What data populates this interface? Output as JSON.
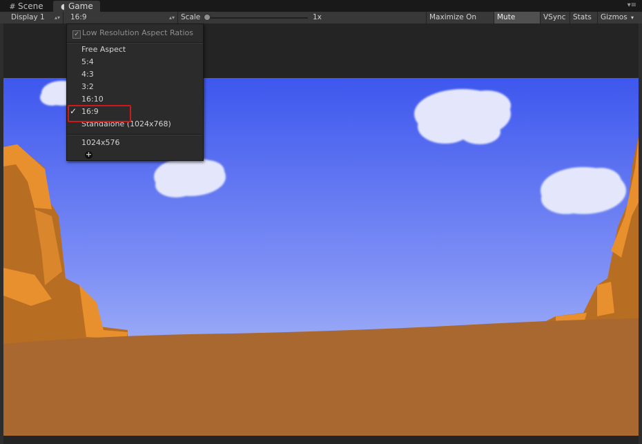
{
  "tabs": [
    {
      "label": "Scene",
      "icon": "grid-icon"
    },
    {
      "label": "Game",
      "icon": "pacman-icon"
    }
  ],
  "toolbar": {
    "display": "Display 1",
    "aspect": "16:9",
    "scale_label": "Scale",
    "scale_value": "1x",
    "maximize": "Maximize On Play",
    "mute": "Mute Audio",
    "vsync": "VSync",
    "stats": "Stats",
    "gizmos": "Gizmos"
  },
  "dropdown": {
    "lowres_label": "Low Resolution Aspect Ratios",
    "lowres_checked": true,
    "options": [
      "Free Aspect",
      "5:4",
      "4:3",
      "3:2",
      "16:10",
      "16:9",
      "Standalone (1024x768)"
    ],
    "selected": "16:9",
    "custom": [
      "1024x576"
    ],
    "checkmark": "✓",
    "add_symbol": "+"
  },
  "colors": {
    "highlight": "#d01818",
    "sky_top": "#3e57ee",
    "sky_bottom": "#a9b8f8",
    "ground": "#a8682f",
    "rock": "#e08d2a"
  }
}
